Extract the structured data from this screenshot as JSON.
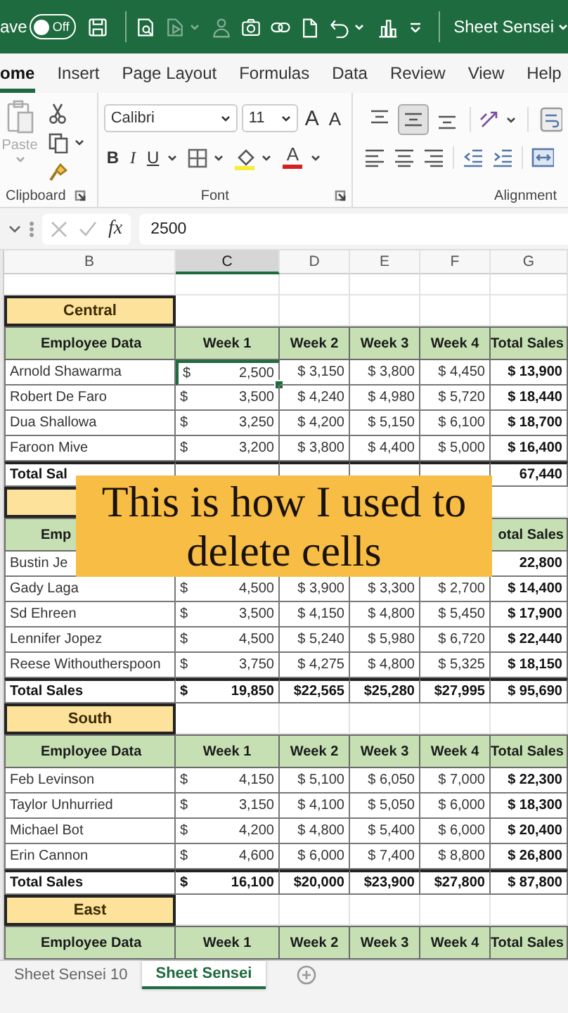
{
  "title_bar": {
    "autosave_label": "ave",
    "autosave": {
      "label": "Off",
      "on": false
    },
    "account": "Sheet Sensei"
  },
  "ribbon_tabs": [
    {
      "label": "ome",
      "selected": true
    },
    {
      "label": "Insert",
      "selected": false
    },
    {
      "label": "Page Layout",
      "selected": false
    },
    {
      "label": "Formulas",
      "selected": false
    },
    {
      "label": "Data",
      "selected": false
    },
    {
      "label": "Review",
      "selected": false
    },
    {
      "label": "View",
      "selected": false
    },
    {
      "label": "Help",
      "selected": false
    }
  ],
  "ribbon": {
    "clipboard": {
      "paste": {
        "label": "Paste",
        "disabled": true
      },
      "label": "Clipboard"
    },
    "font": {
      "name": "Calibri",
      "size": "11",
      "grow": "A",
      "shrink": "A",
      "bold": "B",
      "italic": "I",
      "underline": "U",
      "font_color_letter": "A",
      "label": "Font"
    },
    "alignment": {
      "vertical": [
        {
          "kind": "top",
          "selected": false
        },
        {
          "kind": "middle",
          "selected": true
        },
        {
          "kind": "bottom",
          "selected": false
        }
      ],
      "label": "Alignment"
    }
  },
  "formula_bar": {
    "fx": "fx",
    "value": "2500"
  },
  "columns": [
    {
      "label": "B",
      "selected": false
    },
    {
      "label": "C",
      "selected": true
    },
    {
      "label": "D",
      "selected": false
    },
    {
      "label": "E",
      "selected": false
    },
    {
      "label": "F",
      "selected": false
    },
    {
      "label": "G",
      "selected": false
    }
  ],
  "rows": [
    {
      "kind": "blank"
    },
    {
      "kind": "region",
      "name": "Central"
    },
    {
      "kind": "header",
      "name": "Employee Data",
      "week_1": "Week 1",
      "week_2": "Week 2",
      "week_3": "Week 3",
      "week_4": "Week 4",
      "total": "Total Sales"
    },
    {
      "kind": "data",
      "name": "Arnold Shawarma",
      "week_1": {
        "currency": "$",
        "amount": "2,500",
        "selected": true
      },
      "week_2": "$ 3,150",
      "week_3": "$ 3,800",
      "week_4": "$ 4,450",
      "total": "$ 13,900"
    },
    {
      "kind": "data",
      "name": "Robert De Faro",
      "week_1": {
        "currency": "$",
        "amount": "3,500",
        "selected": false
      },
      "week_2": "$ 4,240",
      "week_3": "$ 4,980",
      "week_4": "$ 5,720",
      "total": "$ 18,440"
    },
    {
      "kind": "data",
      "name": "Dua Shallowa",
      "week_1": {
        "currency": "$",
        "amount": "3,250",
        "selected": false
      },
      "week_2": "$ 4,200",
      "week_3": "$ 5,150",
      "week_4": "$ 6,100",
      "total": "$ 18,700"
    },
    {
      "kind": "data",
      "name": "Faroon Mive",
      "week_1": {
        "currency": "$",
        "amount": "3,200",
        "selected": false
      },
      "week_2": "$ 3,800",
      "week_3": "$ 4,400",
      "week_4": "$ 5,000",
      "total": "$ 16,400"
    },
    {
      "kind": "total",
      "name": "Total Sal",
      "total": "67,440"
    },
    {
      "kind": "region"
    },
    {
      "kind": "header",
      "name": "Emp",
      "total": "otal Sales"
    },
    {
      "kind": "data",
      "name": "Bustin Je",
      "total": "22,800"
    },
    {
      "kind": "data",
      "name": "Gady Laga",
      "week_1": {
        "currency": "$",
        "amount": "4,500",
        "selected": false
      },
      "week_2": "$ 3,900",
      "week_3": "$ 3,300",
      "week_4": "$ 2,700",
      "total": "$ 14,400"
    },
    {
      "kind": "data",
      "name": "Sd Ehreen",
      "week_1": {
        "currency": "$",
        "amount": "3,500",
        "selected": false
      },
      "week_2": "$ 4,150",
      "week_3": "$ 4,800",
      "week_4": "$ 5,450",
      "total": "$ 17,900"
    },
    {
      "kind": "data",
      "name": "Lennifer Jopez",
      "week_1": {
        "currency": "$",
        "amount": "4,500",
        "selected": false
      },
      "week_2": "$ 5,240",
      "week_3": "$ 5,980",
      "week_4": "$ 6,720",
      "total": "$ 22,440"
    },
    {
      "kind": "data",
      "name": "Reese Withoutherspoon",
      "week_1": {
        "currency": "$",
        "amount": "3,750",
        "selected": false
      },
      "week_2": "$ 4,275",
      "week_3": "$ 4,800",
      "week_4": "$ 5,325",
      "total": "$ 18,150"
    },
    {
      "kind": "total",
      "name": "Total Sales",
      "week_1": {
        "currency": "$",
        "amount": "19,850",
        "selected": false
      },
      "week_2": "$22,565",
      "week_3": "$25,280",
      "week_4": "$27,995",
      "total": "$ 95,690"
    },
    {
      "kind": "region",
      "name": "South"
    },
    {
      "kind": "header",
      "name": "Employee Data",
      "week_1": "Week 1",
      "week_2": "Week 2",
      "week_3": "Week 3",
      "week_4": "Week 4",
      "total": "Total Sales"
    },
    {
      "kind": "data",
      "name": "Feb Levinson",
      "week_1": {
        "currency": "$",
        "amount": "4,150",
        "selected": false
      },
      "week_2": "$ 5,100",
      "week_3": "$ 6,050",
      "week_4": "$ 7,000",
      "total": "$ 22,300"
    },
    {
      "kind": "data",
      "name": "Taylor Unhurried",
      "week_1": {
        "currency": "$",
        "amount": "3,150",
        "selected": false
      },
      "week_2": "$ 4,100",
      "week_3": "$ 5,050",
      "week_4": "$ 6,000",
      "total": "$ 18,300"
    },
    {
      "kind": "data",
      "name": "Michael Bot",
      "week_1": {
        "currency": "$",
        "amount": "4,200",
        "selected": false
      },
      "week_2": "$ 4,800",
      "week_3": "$ 5,400",
      "week_4": "$ 6,000",
      "total": "$ 20,400"
    },
    {
      "kind": "data",
      "name": "Erin Cannon",
      "week_1": {
        "currency": "$",
        "amount": "4,600",
        "selected": false
      },
      "week_2": "$ 6,000",
      "week_3": "$ 7,400",
      "week_4": "$ 8,800",
      "total": "$ 26,800"
    },
    {
      "kind": "total",
      "name": "Total Sales",
      "week_1": {
        "currency": "$",
        "amount": "16,100",
        "selected": false
      },
      "week_2": "$20,000",
      "week_3": "$23,900",
      "week_4": "$27,800",
      "total": "$ 87,800"
    },
    {
      "kind": "region",
      "name": "East"
    },
    {
      "kind": "header",
      "name": "Employee Data",
      "week_1": "Week 1",
      "week_2": "Week 2",
      "week_3": "Week 3",
      "week_4": "Week 4",
      "total": "Total Sales"
    }
  ],
  "caption": {
    "lines": [
      "This is how I used to",
      "delete cells"
    ]
  },
  "sheet_tabs": [
    {
      "label": "Sheet Sensei 10",
      "selected": false
    },
    {
      "label": "Sheet Sensei",
      "selected": true
    }
  ]
}
